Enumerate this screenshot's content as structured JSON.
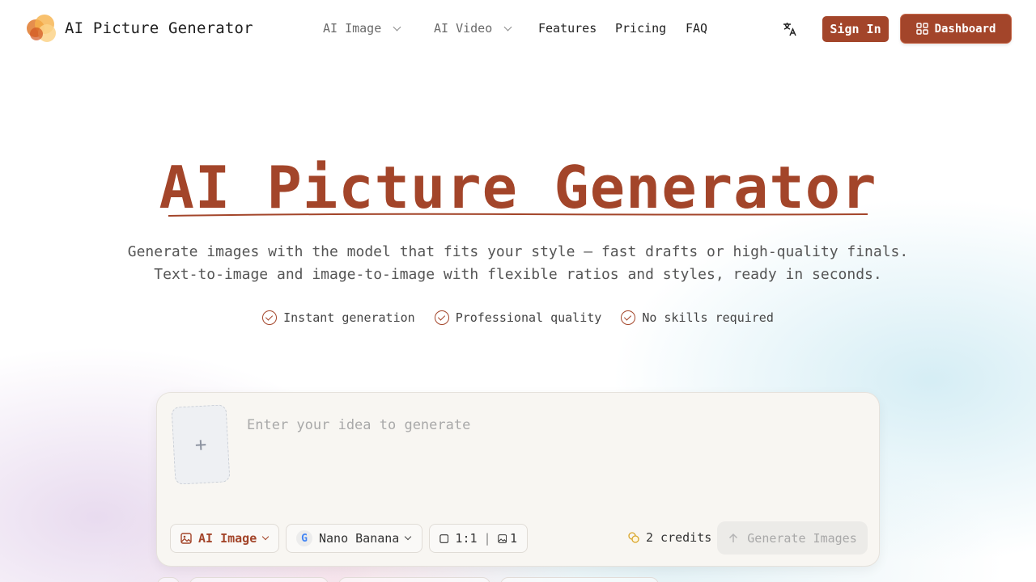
{
  "header": {
    "brand": "AI Picture Generator",
    "nav": [
      {
        "label": "AI Image",
        "dropdown": true
      },
      {
        "label": "AI Video",
        "dropdown": true
      },
      {
        "label": "Features",
        "dropdown": false
      },
      {
        "label": "Pricing",
        "dropdown": false
      },
      {
        "label": "FAQ",
        "dropdown": false
      }
    ],
    "translate_icon": "translate-icon",
    "signin_label": "Sign In",
    "dashboard_label": "Dashboard",
    "dashboard_icon": "grid-icon"
  },
  "hero": {
    "title": "AI Picture Generator",
    "subtitle_line1": "Generate images with the model that fits your style — fast drafts or high-quality finals.",
    "subtitle_line2": "Text-to-image and image-to-image with flexible ratios and styles, ready in seconds.",
    "features": [
      "Instant generation",
      "Professional quality",
      "No skills required"
    ]
  },
  "generator": {
    "upload_symbol": "+",
    "prompt_placeholder": "Enter your idea to generate",
    "mode_label": "AI Image",
    "model_label": "Nano Banana",
    "ratio_label": "1:1",
    "count_label": "1",
    "credits_label": "2 credits",
    "generate_label": "Generate Images"
  },
  "colors": {
    "accent": "#a3452a",
    "card_bg": "#f8f6f2"
  }
}
